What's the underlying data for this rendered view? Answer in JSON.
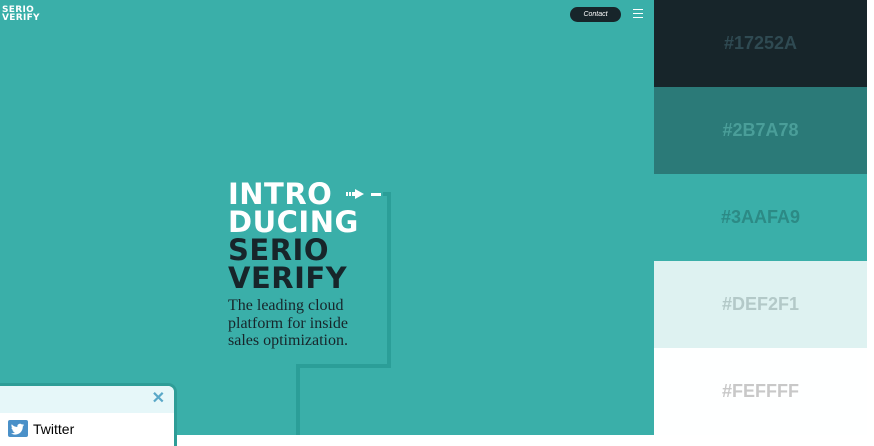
{
  "header": {
    "logo_line1": "SERIO",
    "logo_line2": "VERIFY",
    "contact_label": "Contact",
    "menu_icon": "hamburger-icon"
  },
  "hero": {
    "headline_lines": [
      "INTRO",
      "DUCING",
      "SERIO",
      "VERIFY"
    ],
    "tagline_lines": [
      "The leading cloud",
      "platform for inside",
      "sales optimization."
    ],
    "arrow_icon": "arrow-right-icon"
  },
  "palette": [
    {
      "hex": "#17252A",
      "bg": "#17252A",
      "text": "#2f4a52"
    },
    {
      "hex": "#2B7A78",
      "bg": "#2B7A78",
      "text": "#4a9e99"
    },
    {
      "hex": "#3AAFA9",
      "bg": "#3AAFA9",
      "text": "#2c8a85"
    },
    {
      "hex": "#DEF2F1",
      "bg": "#DEF2F1",
      "text": "#b3c9c8"
    },
    {
      "hex": "#FEFFFF",
      "bg": "#FEFFFF",
      "text": "#c8c8c8"
    }
  ],
  "social_widget": {
    "close_icon": "close-icon",
    "items": [
      {
        "label": "Twitter",
        "icon": "twitter-icon"
      }
    ]
  }
}
